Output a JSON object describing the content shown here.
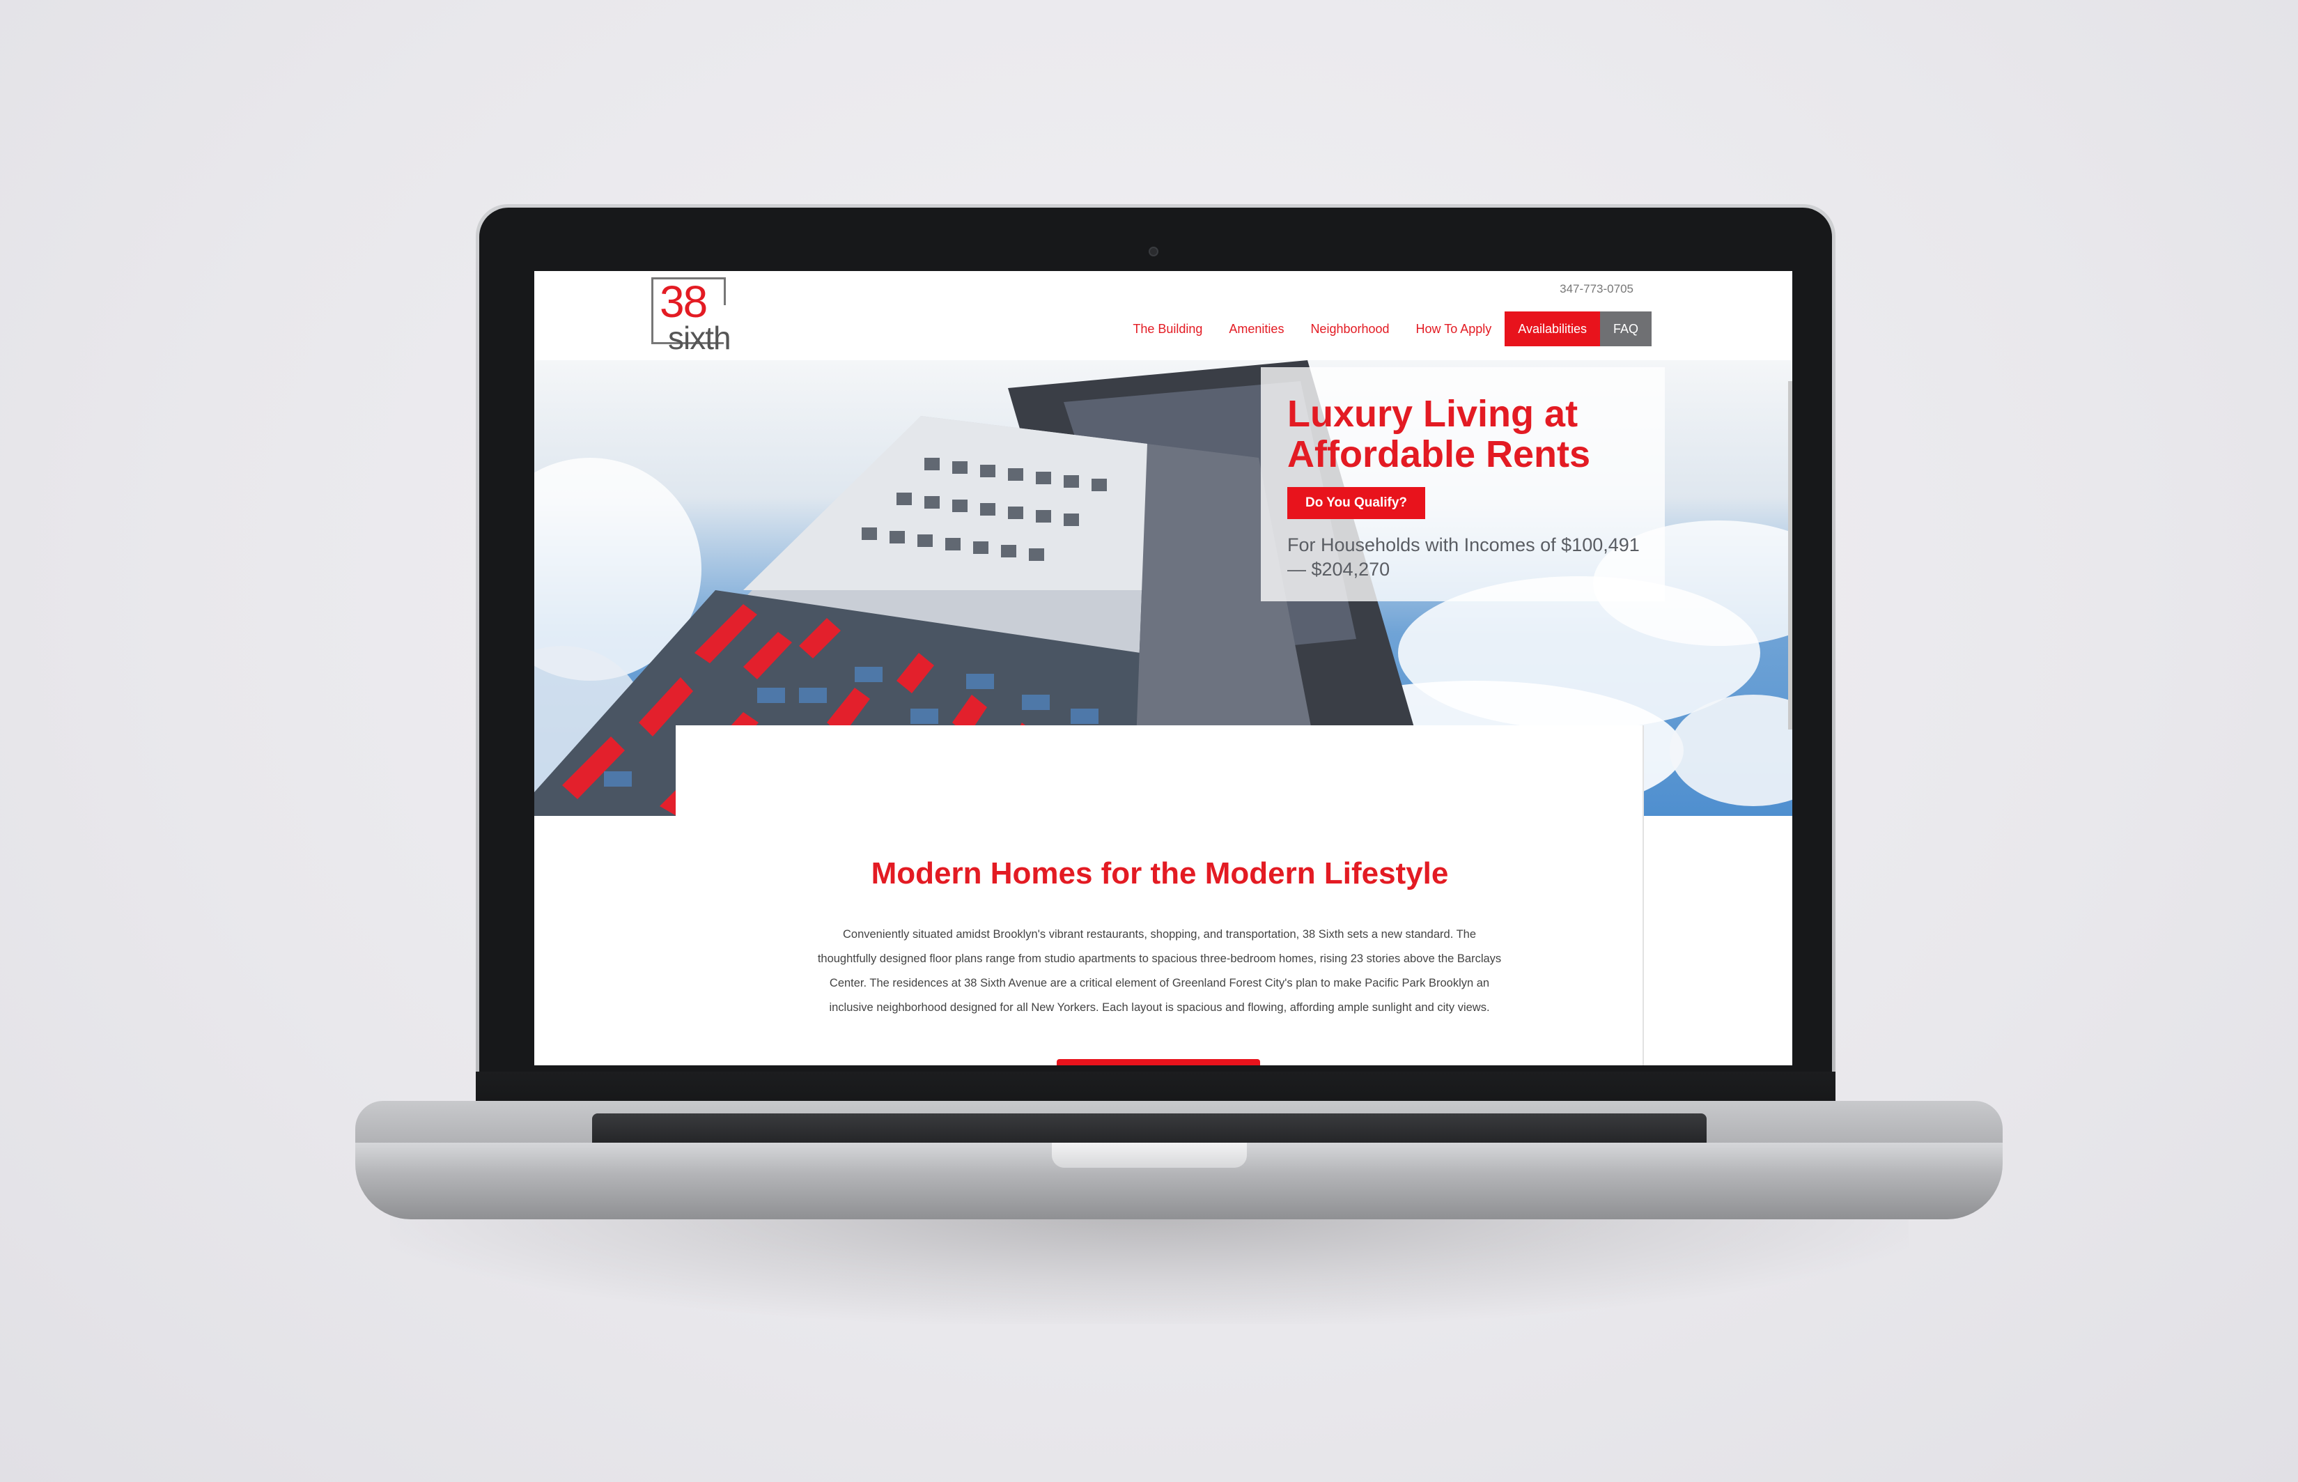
{
  "header": {
    "logo_number": "38",
    "logo_word": "sixth",
    "phone": "347-773-0705"
  },
  "nav": {
    "items": [
      {
        "label": "The Building"
      },
      {
        "label": "Amenities"
      },
      {
        "label": "Neighborhood"
      },
      {
        "label": "How To Apply"
      },
      {
        "label": "Availabilities"
      },
      {
        "label": "FAQ"
      }
    ]
  },
  "hero": {
    "title": "Luxury Living at Affordable Rents",
    "cta_label": "Do You Qualify?",
    "subtitle": "For Households with Incomes of $100,491— $204,270"
  },
  "intro": {
    "title": "Modern Homes for the Modern Lifestyle",
    "body": "Conveniently situated amidst Brooklyn's vibrant restaurants, shopping, and transportation, 38 Sixth sets a new standard. The thoughtfully designed floor plans range from studio apartments to spacious three-bedroom homes, rising 23 stories above the Barclays Center. The residences at 38 Sixth Avenue are a critical element of Greenland Forest City's plan to make Pacific Park Brooklyn an inclusive neighborhood designed for all New Yorkers. Each layout is spacious and flowing, affording ample sunlight and city views."
  },
  "colors": {
    "brand_red": "#e31b23",
    "nav_dark": "#6f7073"
  }
}
